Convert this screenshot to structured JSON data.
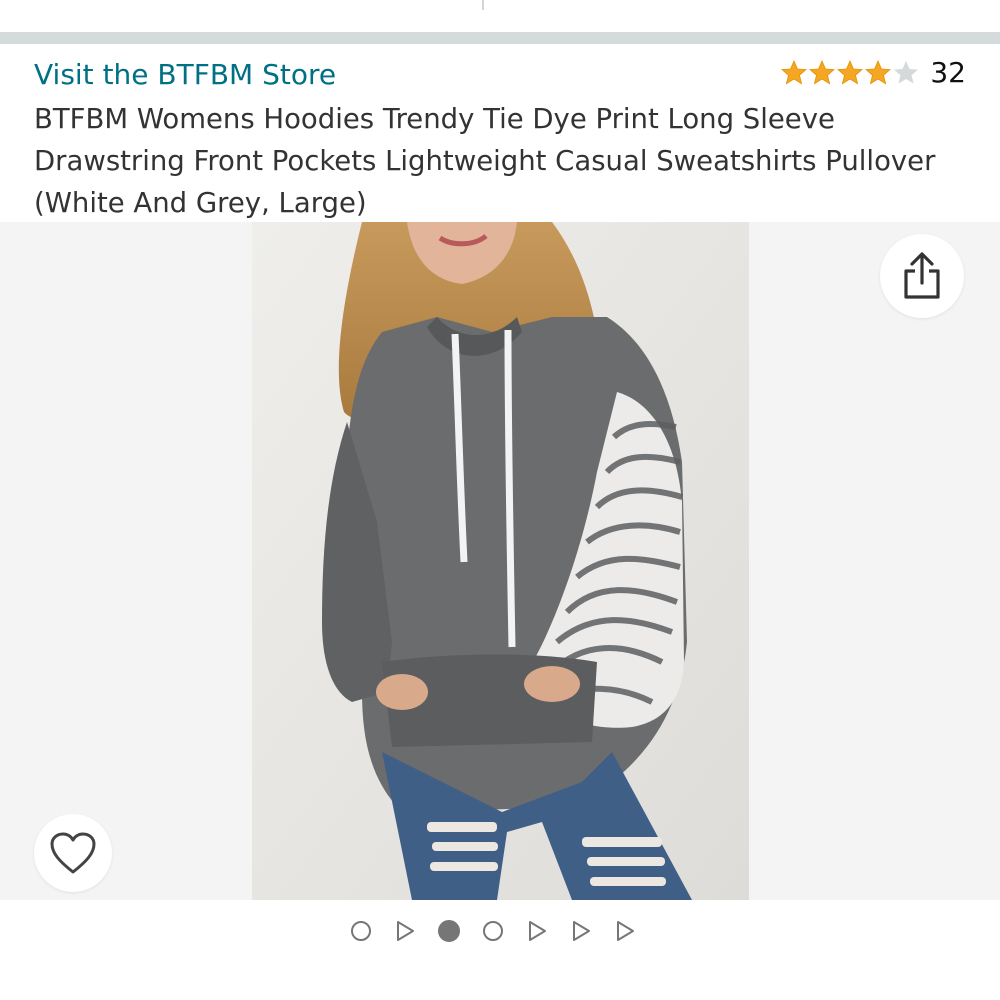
{
  "header": {
    "store_link": "Visit the BTFBM Store",
    "rating": {
      "stars": 4,
      "max_stars": 5,
      "count": "32",
      "star_color": "#f5a623",
      "empty_star_color": "#d5d9d9"
    },
    "title": "BTFBM Womens Hoodies Trendy Tie Dye Print Long Sleeve Drawstring Front Pockets Lightweight Casual Sweatshirts Pullover (White And Grey, Large)"
  },
  "gallery": {
    "image_icon": "product-photo-hoodie",
    "share_icon": "share-icon",
    "wishlist_icon": "heart-icon",
    "indicators": [
      {
        "type": "image",
        "active": false
      },
      {
        "type": "video",
        "active": false
      },
      {
        "type": "image",
        "active": true
      },
      {
        "type": "image",
        "active": false
      },
      {
        "type": "video",
        "active": false
      },
      {
        "type": "video",
        "active": false
      },
      {
        "type": "video",
        "active": false
      }
    ]
  },
  "colors": {
    "link": "#007185",
    "divider": "#d5dbdb",
    "indicator": "#767676"
  }
}
